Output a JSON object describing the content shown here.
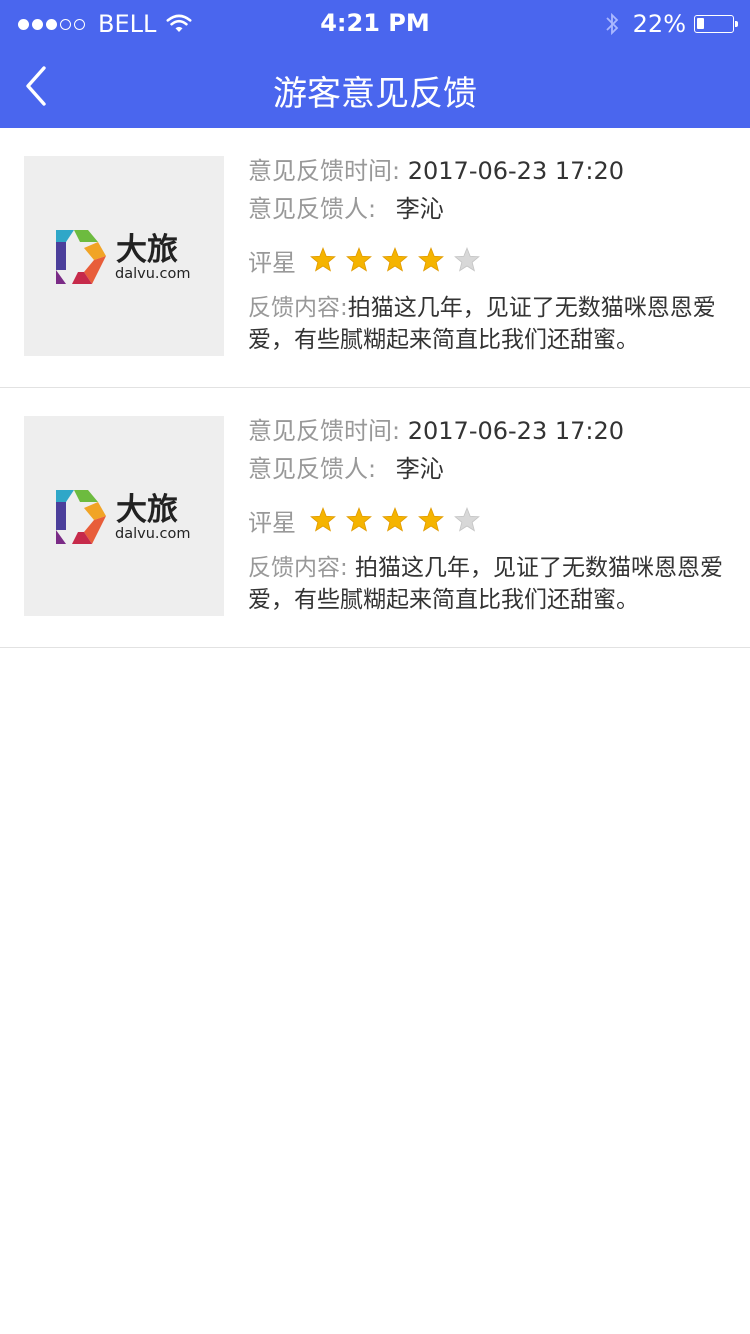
{
  "status": {
    "carrier": "BELL",
    "time": "4:21 PM",
    "battery": "22%",
    "battery_level": 0.22,
    "signal_bars": 3,
    "signal_total": 5
  },
  "nav": {
    "title": "游客意见反馈"
  },
  "feedback_items": [
    {
      "time_label": "意见反馈时间:",
      "time_value": "2017-06-23 17:20",
      "person_label": "意见反馈人:",
      "person_value": "李沁",
      "rating_label": "评星",
      "rating": 4,
      "rating_max": 5,
      "content_label": "反馈内容:",
      "content_value": "拍猫这几年，见证了无数猫咪恩恩爱爱，有些腻糊起来简直比我们还甜蜜。",
      "logo_text": "大旅",
      "logo_sub": "dalvu.com"
    },
    {
      "time_label": "意见反馈时间:",
      "time_value": "2017-06-23 17:20",
      "person_label": "意见反馈人:",
      "person_value": "李沁",
      "rating_label": "评星",
      "rating": 4,
      "rating_max": 5,
      "content_label": "反馈内容:",
      "content_value": " 拍猫这几年，见证了无数猫咪恩恩爱爱，有些腻糊起来简直比我们还甜蜜。",
      "logo_text": "大旅",
      "logo_sub": "dalvu.com"
    }
  ],
  "colors": {
    "header": "#4a66ee",
    "star_on": "#f5b400",
    "star_off": "#d8d8d8"
  }
}
